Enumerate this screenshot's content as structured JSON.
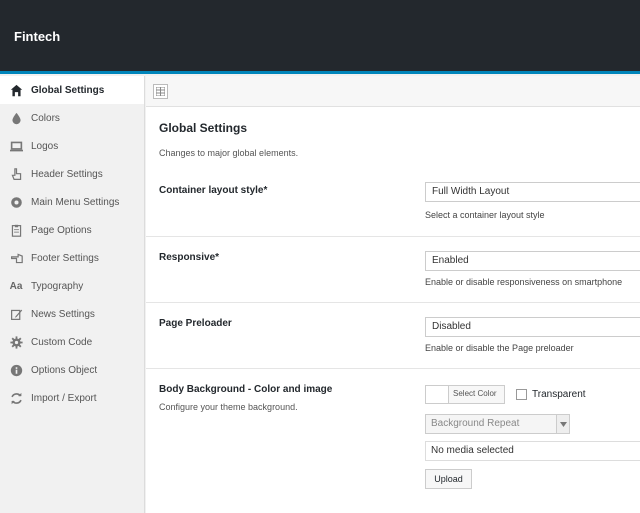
{
  "header": {
    "brand": "Fintech"
  },
  "sidebar": {
    "items": [
      {
        "label": "Global Settings",
        "icon": "home-icon"
      },
      {
        "label": "Colors",
        "icon": "droplet-icon"
      },
      {
        "label": "Logos",
        "icon": "laptop-icon"
      },
      {
        "label": "Header Settings",
        "icon": "pointer-icon"
      },
      {
        "label": "Main Menu Settings",
        "icon": "circle-dot-icon"
      },
      {
        "label": "Page Options",
        "icon": "clipboard-icon"
      },
      {
        "label": "Footer Settings",
        "icon": "pointer-down-icon"
      },
      {
        "label": "Typography",
        "icon": "typography-icon",
        "glyph": "Aa"
      },
      {
        "label": "News Settings",
        "icon": "edit-icon"
      },
      {
        "label": "Custom Code",
        "icon": "gear-icon"
      },
      {
        "label": "Options Object",
        "icon": "info-icon"
      },
      {
        "label": "Import / Export",
        "icon": "refresh-icon"
      }
    ]
  },
  "main": {
    "title": "Global Settings",
    "description": "Changes to major global elements.",
    "fields": {
      "container_layout": {
        "label": "Container layout style*",
        "value": "Full Width Layout",
        "help": "Select a container layout style"
      },
      "responsive": {
        "label": "Responsive*",
        "value": "Enabled",
        "help": "Enable or disable responsiveness on smartphone"
      },
      "preloader": {
        "label": "Page Preloader",
        "value": "Disabled",
        "help": "Enable or disable the Page preloader"
      },
      "body_background": {
        "label": "Body Background - Color and image",
        "sublabel": "Configure your theme background.",
        "select_color": "Select Color",
        "transparent": "Transparent",
        "repeat_placeholder": "Background Repeat",
        "media_value": "No media selected",
        "upload": "Upload"
      }
    }
  },
  "colors": {
    "topbar": "#23282d",
    "accent": "#0085ba"
  }
}
